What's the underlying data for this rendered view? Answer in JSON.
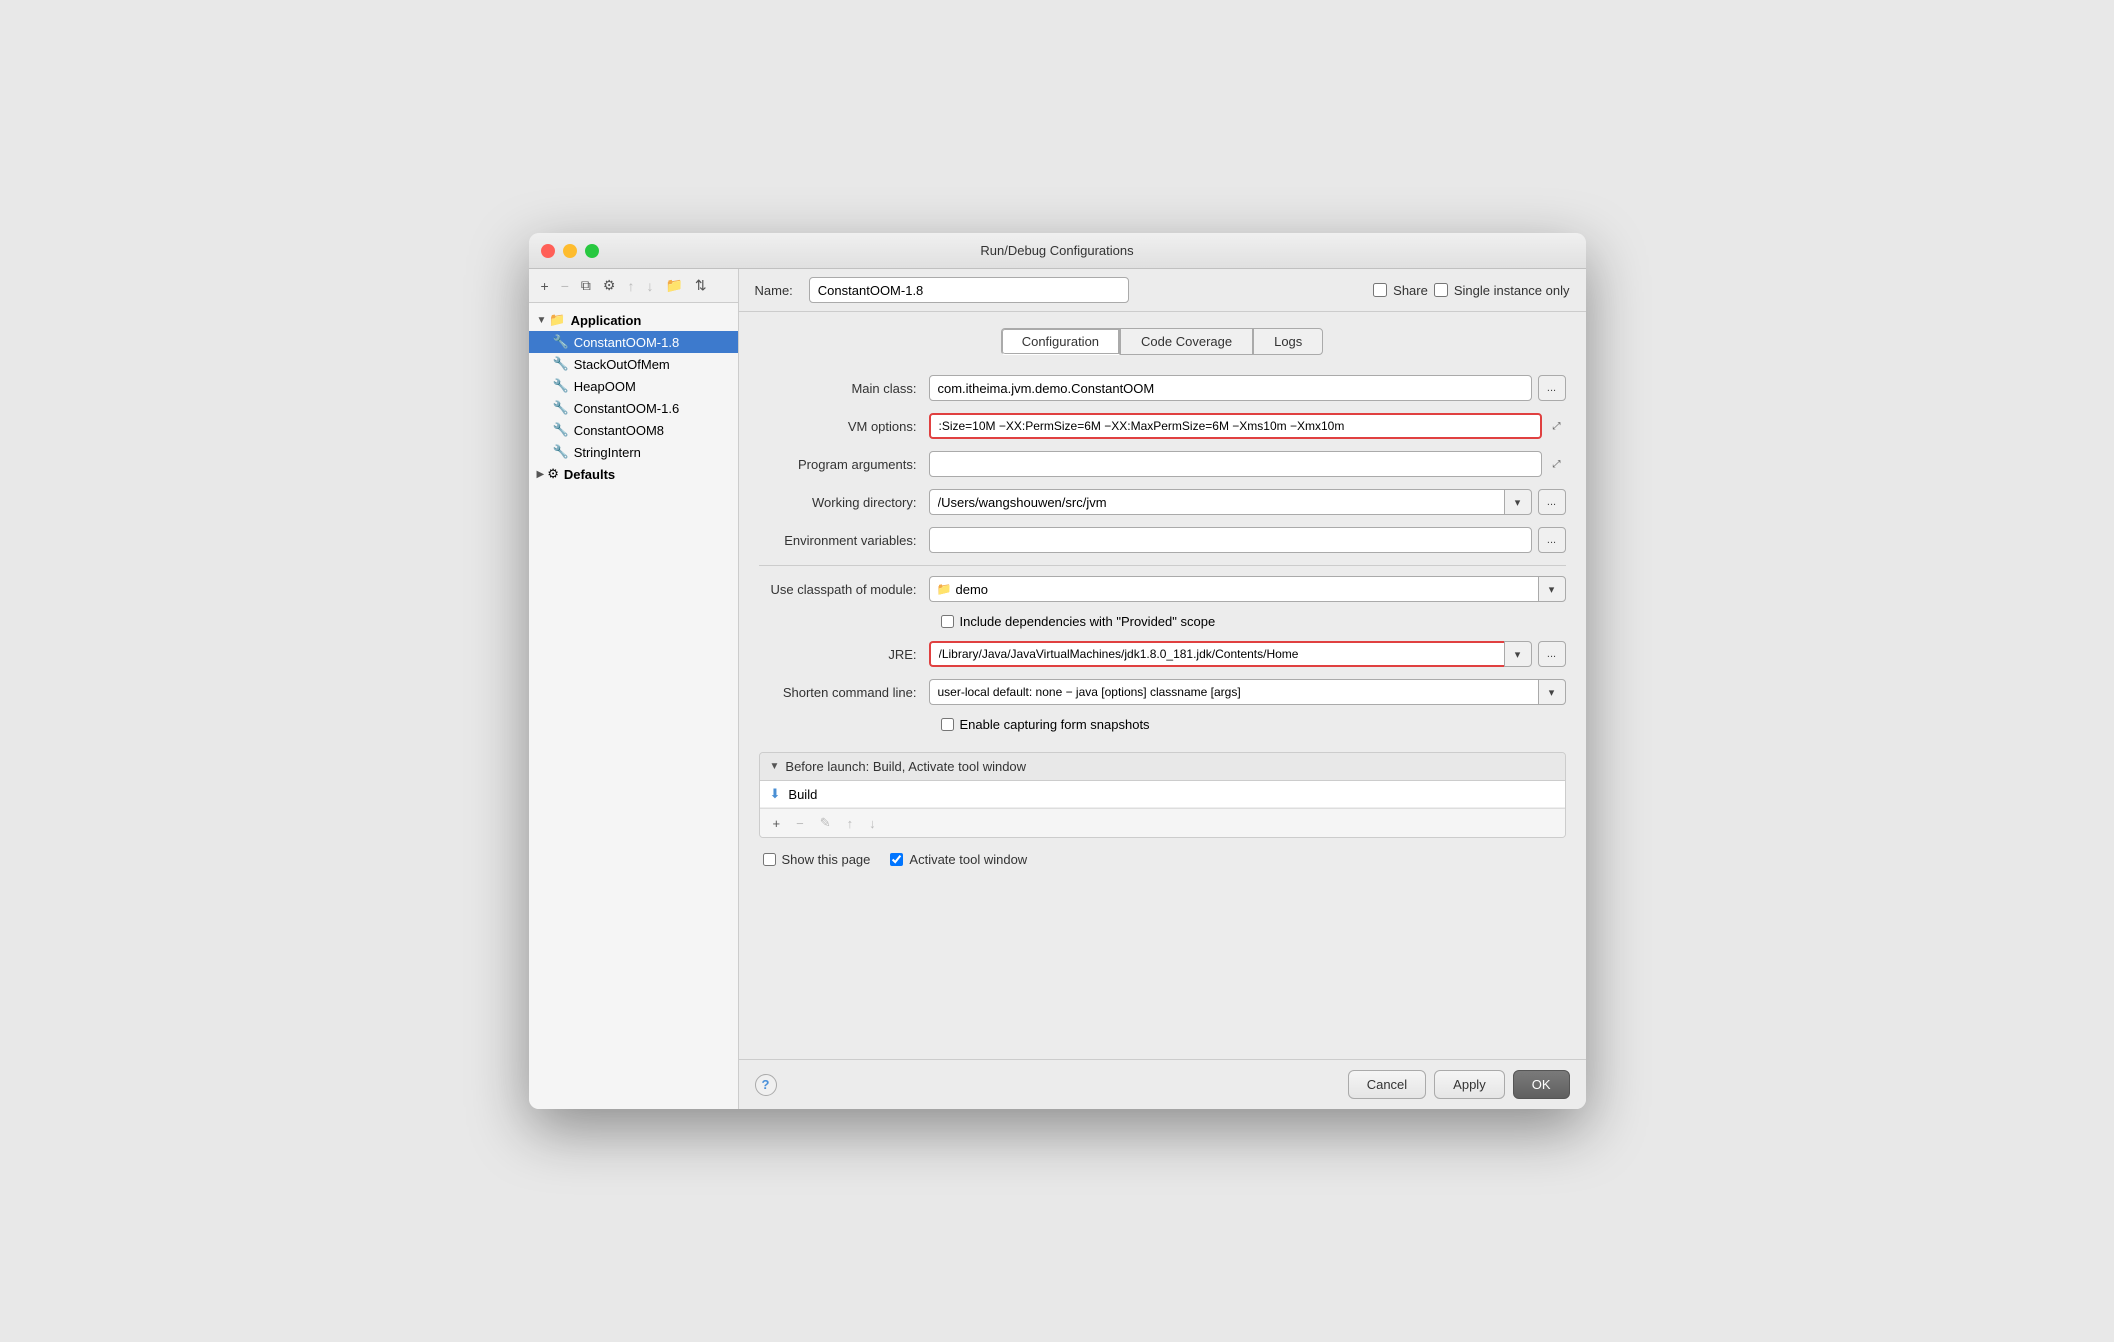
{
  "window": {
    "title": "Run/Debug Configurations"
  },
  "titlebar": {
    "btn_close": "×",
    "btn_minimize": "−",
    "btn_maximize": "+"
  },
  "toolbar": {
    "add_label": "+",
    "remove_label": "−",
    "copy_label": "⧉",
    "settings_label": "⚙",
    "up_label": "↑",
    "down_label": "↓",
    "folder_label": "📁",
    "sort_label": "⇅"
  },
  "tree": {
    "items": [
      {
        "id": "application",
        "label": "Application",
        "level": 0,
        "bold": true,
        "expanded": true,
        "icon": "▼",
        "selected": false
      },
      {
        "id": "constantoom18",
        "label": "ConstantOOM-1.8",
        "level": 1,
        "bold": false,
        "icon": "🔧",
        "selected": true
      },
      {
        "id": "stackoutofmem",
        "label": "StackOutOfMem",
        "level": 1,
        "bold": false,
        "icon": "🔧",
        "selected": false
      },
      {
        "id": "heapoom",
        "label": "HeapOOM",
        "level": 1,
        "bold": false,
        "icon": "🔧",
        "selected": false
      },
      {
        "id": "constantoom16",
        "label": "ConstantOOM-1.6",
        "level": 1,
        "bold": false,
        "icon": "🔧",
        "selected": false
      },
      {
        "id": "constantoom8",
        "label": "ConstantOOM8",
        "level": 1,
        "bold": false,
        "icon": "🔧",
        "selected": false
      },
      {
        "id": "stringintern",
        "label": "StringIntern",
        "level": 1,
        "bold": false,
        "icon": "🔧",
        "selected": false
      },
      {
        "id": "defaults",
        "label": "Defaults",
        "level": 0,
        "bold": true,
        "expanded": false,
        "icon": "▶",
        "selected": false
      }
    ]
  },
  "header": {
    "name_label": "Name:",
    "name_value": "ConstantOOM-1.8",
    "share_label": "Share",
    "single_instance_label": "Single instance only"
  },
  "tabs": [
    {
      "id": "configuration",
      "label": "Configuration",
      "active": true
    },
    {
      "id": "code_coverage",
      "label": "Code Coverage",
      "active": false
    },
    {
      "id": "logs",
      "label": "Logs",
      "active": false
    }
  ],
  "form": {
    "main_class_label": "Main class:",
    "main_class_value": "com.itheima.jvm.demo.ConstantOOM",
    "vm_options_label": "VM options:",
    "vm_options_value": ":Size=10M −XX:PermSize=6M −XX:MaxPermSize=6M −Xms10m −Xmx10m",
    "program_args_label": "Program arguments:",
    "program_args_value": "",
    "working_dir_label": "Working directory:",
    "working_dir_value": "/Users/wangshouwen/src/jvm",
    "env_vars_label": "Environment variables:",
    "env_vars_value": "",
    "classpath_label": "Use classpath of module:",
    "classpath_value": "demo",
    "include_deps_label": "Include dependencies with \"Provided\" scope",
    "jre_label": "JRE:",
    "jre_value": "/Library/Java/JavaVirtualMachines/jdk1.8.0_181.jdk/Contents/Home",
    "shorten_cmd_label": "Shorten command line:",
    "shorten_cmd_value": "user-local default: none − java [options] classname [args]",
    "enable_snapshots_label": "Enable capturing form snapshots",
    "browse_label": "...",
    "expand_label": "⤢"
  },
  "before_launch": {
    "header": "Before launch: Build, Activate tool window",
    "items": [
      {
        "label": "Build",
        "icon": "⬇"
      }
    ],
    "toolbar": {
      "add": "+",
      "remove": "−",
      "edit": "✎",
      "up": "↑",
      "down": "↓"
    }
  },
  "bottom": {
    "show_page_label": "Show this page",
    "activate_window_label": "Activate tool window"
  },
  "footer": {
    "help_label": "?",
    "cancel_label": "Cancel",
    "apply_label": "Apply",
    "ok_label": "OK"
  }
}
